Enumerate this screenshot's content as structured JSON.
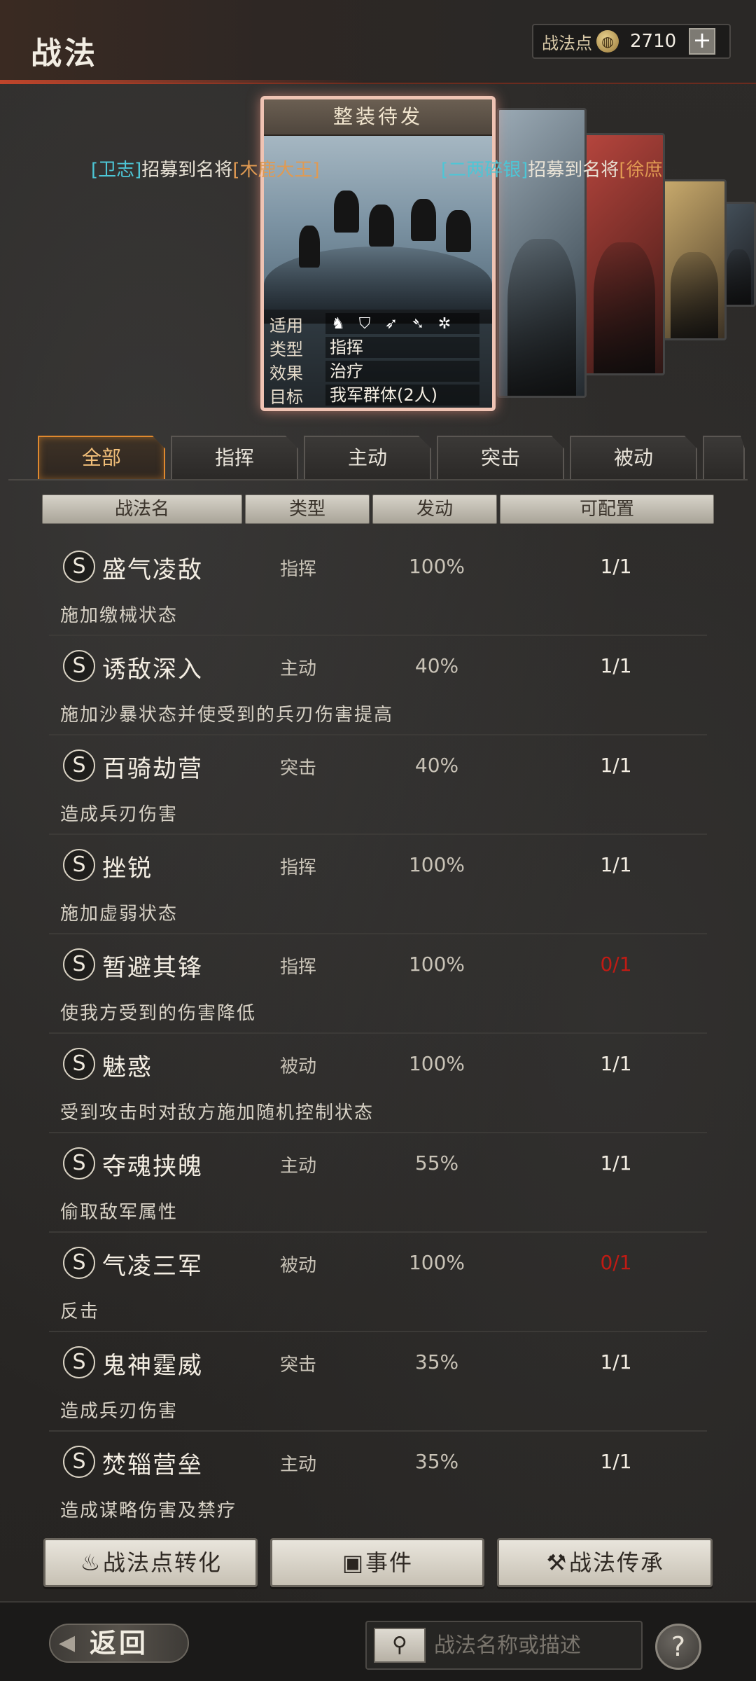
{
  "header": {
    "title": "战法",
    "points_label": "战法点",
    "points_value": "2710",
    "plus_label": "+"
  },
  "card": {
    "title": "整装待发",
    "rows": [
      {
        "key": "适用",
        "value": ""
      },
      {
        "key": "类型",
        "value": "指挥"
      },
      {
        "key": "效果",
        "value": "治疗"
      },
      {
        "key": "目标",
        "value": "我军群体(2人)"
      }
    ],
    "type_icons": [
      "cavalry-icon",
      "shield-icon",
      "bow-icon",
      "spear-icon",
      "wheel-icon"
    ]
  },
  "ticker": {
    "left": {
      "name": "[卫志]",
      "middle": "招募到名将",
      "general": "[木鹿大王]"
    },
    "right": {
      "name": "[二两碎银]",
      "middle": "招募到名将",
      "general": "[徐庶"
    }
  },
  "tabs": [
    {
      "label": "全部",
      "active": true
    },
    {
      "label": "指挥",
      "active": false
    },
    {
      "label": "主动",
      "active": false
    },
    {
      "label": "突击",
      "active": false
    },
    {
      "label": "被动",
      "active": false
    }
  ],
  "columns": {
    "name": "战法名",
    "type": "类型",
    "rate": "发动",
    "config": "可配置"
  },
  "tactics": [
    {
      "grade": "S",
      "name": "盛气凌敌",
      "type": "指挥",
      "rate": "100%",
      "config": "1/1",
      "red": false,
      "desc": "施加缴械状态"
    },
    {
      "grade": "S",
      "name": "诱敌深入",
      "type": "主动",
      "rate": "40%",
      "config": "1/1",
      "red": false,
      "desc": "施加沙暴状态并使受到的兵刃伤害提高"
    },
    {
      "grade": "S",
      "name": "百骑劫营",
      "type": "突击",
      "rate": "40%",
      "config": "1/1",
      "red": false,
      "desc": "造成兵刃伤害"
    },
    {
      "grade": "S",
      "name": "挫锐",
      "type": "指挥",
      "rate": "100%",
      "config": "1/1",
      "red": false,
      "desc": "施加虚弱状态"
    },
    {
      "grade": "S",
      "name": "暂避其锋",
      "type": "指挥",
      "rate": "100%",
      "config": "0/1",
      "red": true,
      "desc": "使我方受到的伤害降低"
    },
    {
      "grade": "S",
      "name": "魅惑",
      "type": "被动",
      "rate": "100%",
      "config": "1/1",
      "red": false,
      "desc": "受到攻击时对敌方施加随机控制状态"
    },
    {
      "grade": "S",
      "name": "夺魂挟魄",
      "type": "主动",
      "rate": "55%",
      "config": "1/1",
      "red": false,
      "desc": "偷取敌军属性"
    },
    {
      "grade": "S",
      "name": "气凌三军",
      "type": "被动",
      "rate": "100%",
      "config": "0/1",
      "red": true,
      "desc": "反击"
    },
    {
      "grade": "S",
      "name": "鬼神霆威",
      "type": "突击",
      "rate": "35%",
      "config": "1/1",
      "red": false,
      "desc": "造成兵刃伤害"
    },
    {
      "grade": "S",
      "name": "焚辎营垒",
      "type": "主动",
      "rate": "35%",
      "config": "1/1",
      "red": false,
      "desc": "造成谋略伤害及禁疗"
    }
  ],
  "bottom_buttons": {
    "convert": "战法点转化",
    "event": "事件",
    "inherit": "战法传承"
  },
  "footer": {
    "back": "返回",
    "search_placeholder": "战法名称或描述",
    "help": "?"
  },
  "colors": {
    "accent": "#e0892e",
    "header_red": "#c0452b",
    "ticker_cyan": "#4dc6d6",
    "ticker_orange": "#e09a52",
    "config_red": "#c01b14"
  }
}
